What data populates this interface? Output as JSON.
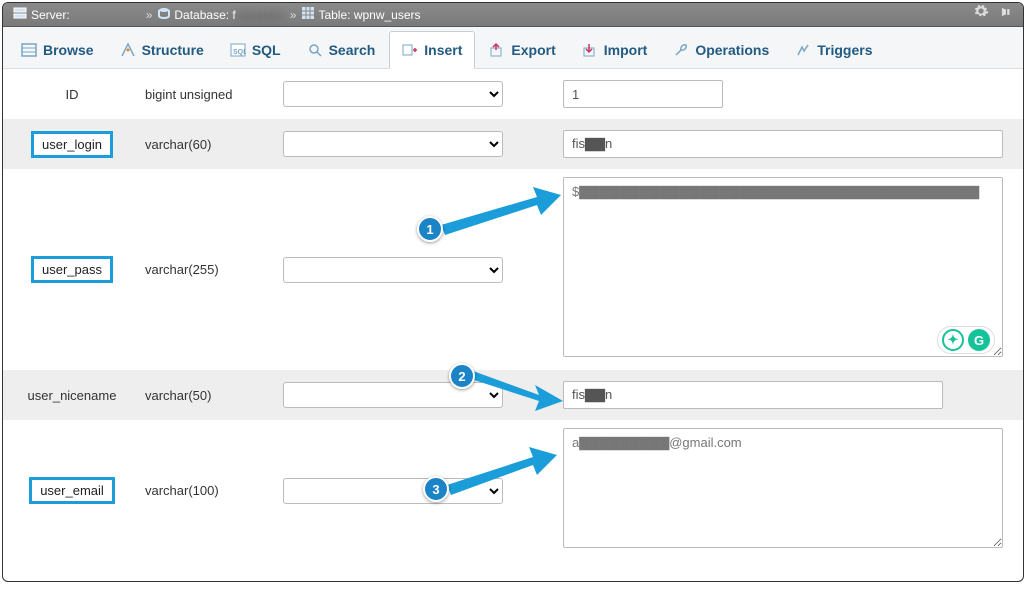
{
  "breadcrumb": {
    "server_label": "Server:",
    "server_value": " ",
    "db_label": "Database:",
    "db_value": "f",
    "table_label": "Table:",
    "table_value": "wpnw_users"
  },
  "tabs": [
    {
      "id": "browse",
      "label": "Browse"
    },
    {
      "id": "structure",
      "label": "Structure"
    },
    {
      "id": "sql",
      "label": "SQL"
    },
    {
      "id": "search",
      "label": "Search"
    },
    {
      "id": "insert",
      "label": "Insert"
    },
    {
      "id": "export",
      "label": "Export"
    },
    {
      "id": "import",
      "label": "Import"
    },
    {
      "id": "operations",
      "label": "Operations"
    },
    {
      "id": "triggers",
      "label": "Triggers"
    }
  ],
  "active_tab": "insert",
  "fields": {
    "id": {
      "name": "ID",
      "type": "bigint unsigned",
      "value": "1",
      "highlight": false
    },
    "user_login": {
      "name": "user_login",
      "type": "varchar(60)",
      "value": "fis▇▇n",
      "highlight": true
    },
    "user_pass": {
      "name": "user_pass",
      "type": "varchar(255)",
      "value": "$▇▇▇▇▇▇▇▇▇▇▇▇▇▇▇▇▇▇▇▇▇▇▇▇▇▇▇▇▇▇▇▇▇▇▇▇▇▇▇▇",
      "highlight": true,
      "textarea": true
    },
    "user_nicename": {
      "name": "user_nicename",
      "type": "varchar(50)",
      "value": "fis▇▇n",
      "highlight": false
    },
    "user_email": {
      "name": "user_email",
      "type": "varchar(100)",
      "value": "a▇▇▇▇▇▇▇▇▇@gmail.com",
      "highlight": true,
      "textarea": true
    }
  },
  "annotations": {
    "a1": "1",
    "a2": "2",
    "a3": "3"
  },
  "grammarly_glyph": "G"
}
